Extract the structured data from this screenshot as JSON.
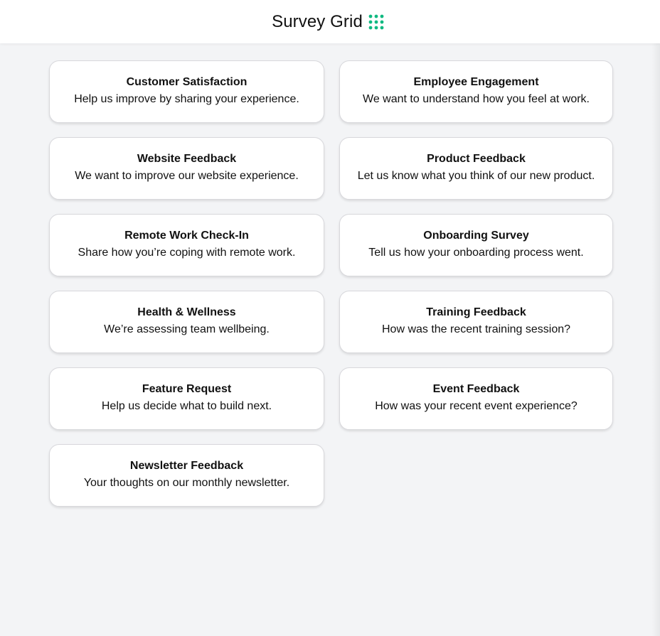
{
  "header": {
    "title": "Survey Grid",
    "icon": "grid-dots-icon",
    "accent_color": "#10b981"
  },
  "surveys": [
    {
      "title": "Customer Satisfaction",
      "description": "Help us improve by sharing your experience."
    },
    {
      "title": "Employee Engagement",
      "description": "We want to understand how you feel at work."
    },
    {
      "title": "Website Feedback",
      "description": "We want to improve our website experience."
    },
    {
      "title": "Product Feedback",
      "description": "Let us know what you think of our new product."
    },
    {
      "title": "Remote Work Check-In",
      "description": "Share how you’re coping with remote work."
    },
    {
      "title": "Onboarding Survey",
      "description": "Tell us how your onboarding process went."
    },
    {
      "title": "Health & Wellness",
      "description": "We’re assessing team wellbeing."
    },
    {
      "title": "Training Feedback",
      "description": "How was the recent training session?"
    },
    {
      "title": "Feature Request",
      "description": "Help us decide what to build next."
    },
    {
      "title": "Event Feedback",
      "description": "How was your recent event experience?"
    },
    {
      "title": "Newsletter Feedback",
      "description": "Your thoughts on our monthly newsletter."
    }
  ]
}
